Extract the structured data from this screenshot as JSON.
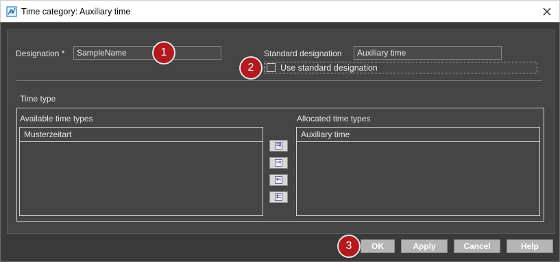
{
  "window": {
    "title": "Time category: Auxiliary time",
    "app_icon": "time-category-app-icon",
    "close_icon": "close-icon"
  },
  "form": {
    "designation_label": "Designation *",
    "designation_value": "SampleName",
    "standard_designation_label": "Standard designation",
    "standard_designation_value": "Auxiliary time",
    "use_standard_label": "Use standard designation",
    "use_standard_checked": false
  },
  "time_type": {
    "section_label": "Time type",
    "available_label": "Available time types",
    "available_items": [
      "Musterzeitart"
    ],
    "allocated_label": "Allocated time types",
    "allocated_items": [
      "Auxiliary time"
    ],
    "move_buttons": [
      {
        "name": "move-all-right-button",
        "glyph": "⇉"
      },
      {
        "name": "move-right-button",
        "glyph": "→"
      },
      {
        "name": "move-left-button",
        "glyph": "←"
      },
      {
        "name": "move-all-left-button",
        "glyph": "⇇"
      }
    ]
  },
  "footer": {
    "ok_label": "OK",
    "apply_label": "Apply",
    "cancel_label": "Cancel",
    "help_label": "Help"
  },
  "callouts": [
    "1",
    "2",
    "3"
  ],
  "colors": {
    "dialog_bg": "#3a3a3a",
    "panel_bg": "#454545",
    "callout_red": "#b11a1f",
    "button_bg": "#b4b4b4"
  }
}
